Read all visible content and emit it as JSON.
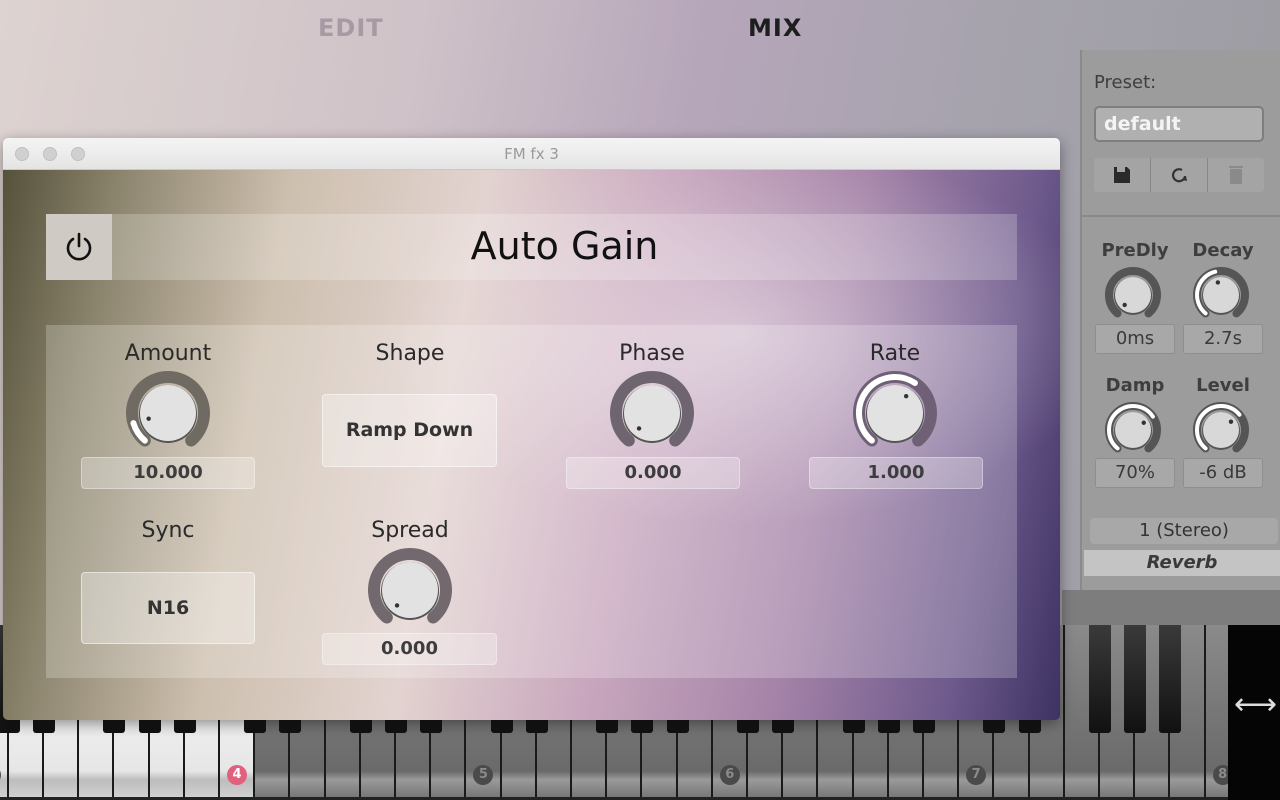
{
  "tabs": [
    {
      "label": "EDIT",
      "active": false
    },
    {
      "label": "MIX",
      "active": true
    }
  ],
  "preset": {
    "label": "Preset:",
    "value": "default",
    "buttons": [
      "save-icon",
      "reload-icon",
      "delete-icon"
    ]
  },
  "reverb": {
    "knobs": [
      {
        "label": "PreDly",
        "value": "0ms",
        "level": 0.0
      },
      {
        "label": "Decay",
        "value": "2.7s",
        "level": 0.45
      },
      {
        "label": "Damp",
        "value": "70%",
        "level": 0.7
      },
      {
        "label": "Level",
        "value": "-6 dB",
        "level": 0.68
      }
    ],
    "channel": "1 (Stereo)",
    "name": "Reverb"
  },
  "window": {
    "title": "FM fx 3"
  },
  "plugin": {
    "title": "Auto Gain",
    "power_icon": "power-icon",
    "amount": {
      "label": "Amount",
      "value": "10.000",
      "level": 0.12
    },
    "shape": {
      "label": "Shape",
      "value": "Ramp Down"
    },
    "phase": {
      "label": "Phase",
      "value": "0.000",
      "level": 0.0
    },
    "rate": {
      "label": "Rate",
      "value": "1.000",
      "level": 0.62
    },
    "sync": {
      "label": "Sync",
      "value": "N16"
    },
    "spread": {
      "label": "Spread",
      "value": "0.000",
      "level": 0.0
    }
  },
  "keyboard": {
    "octave_labels": [
      "4",
      "5",
      "6",
      "7",
      "8"
    ],
    "highlight_color": "#e0607e",
    "resize_icon": "resize-horizontal-icon",
    "resize_glyph": "⟷"
  },
  "colors": {
    "accent": "#e0607e"
  }
}
